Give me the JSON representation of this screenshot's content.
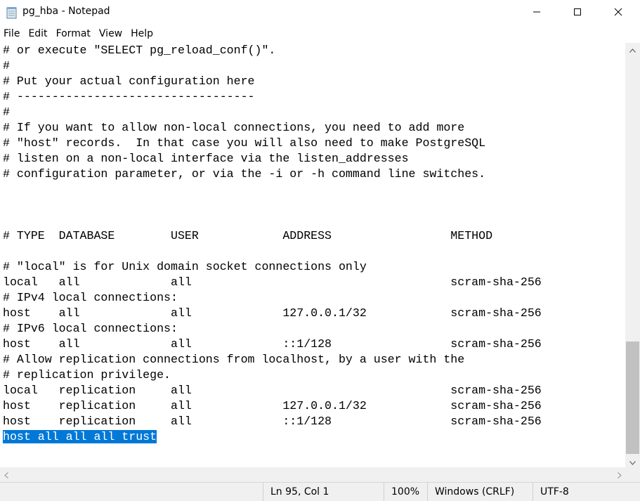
{
  "window": {
    "title": "pg_hba - Notepad",
    "icon": "notepad-icon",
    "controls": [
      "minimize-icon",
      "maximize-icon",
      "close-icon"
    ]
  },
  "menu": [
    "File",
    "Edit",
    "Format",
    "View",
    "Help"
  ],
  "editor": {
    "lines": [
      "# or execute \"SELECT pg_reload_conf()\".",
      "#",
      "# Put your actual configuration here",
      "# ----------------------------------",
      "#",
      "# If you want to allow non-local connections, you need to add more",
      "# \"host\" records.  In that case you will also need to make PostgreSQL",
      "# listen on a non-local interface via the listen_addresses",
      "# configuration parameter, or via the -i or -h command line switches.",
      "",
      "",
      "",
      "# TYPE  DATABASE        USER            ADDRESS                 METHOD",
      "",
      "# \"local\" is for Unix domain socket connections only",
      "local   all             all                                     scram-sha-256",
      "# IPv4 local connections:",
      "host    all             all             127.0.0.1/32            scram-sha-256",
      "# IPv6 local connections:",
      "host    all             all             ::1/128                 scram-sha-256",
      "# Allow replication connections from localhost, by a user with the",
      "# replication privilege.",
      "local   replication     all                                     scram-sha-256",
      "host    replication     all             127.0.0.1/32            scram-sha-256",
      "host    replication     all             ::1/128                 scram-sha-256",
      "host all all all trust"
    ],
    "selected_line_index": 25,
    "selection_color": "#0078d7"
  },
  "status": {
    "position": "Ln 95, Col 1",
    "zoom": "100%",
    "line_ending": "Windows (CRLF)",
    "encoding": "UTF-8"
  }
}
